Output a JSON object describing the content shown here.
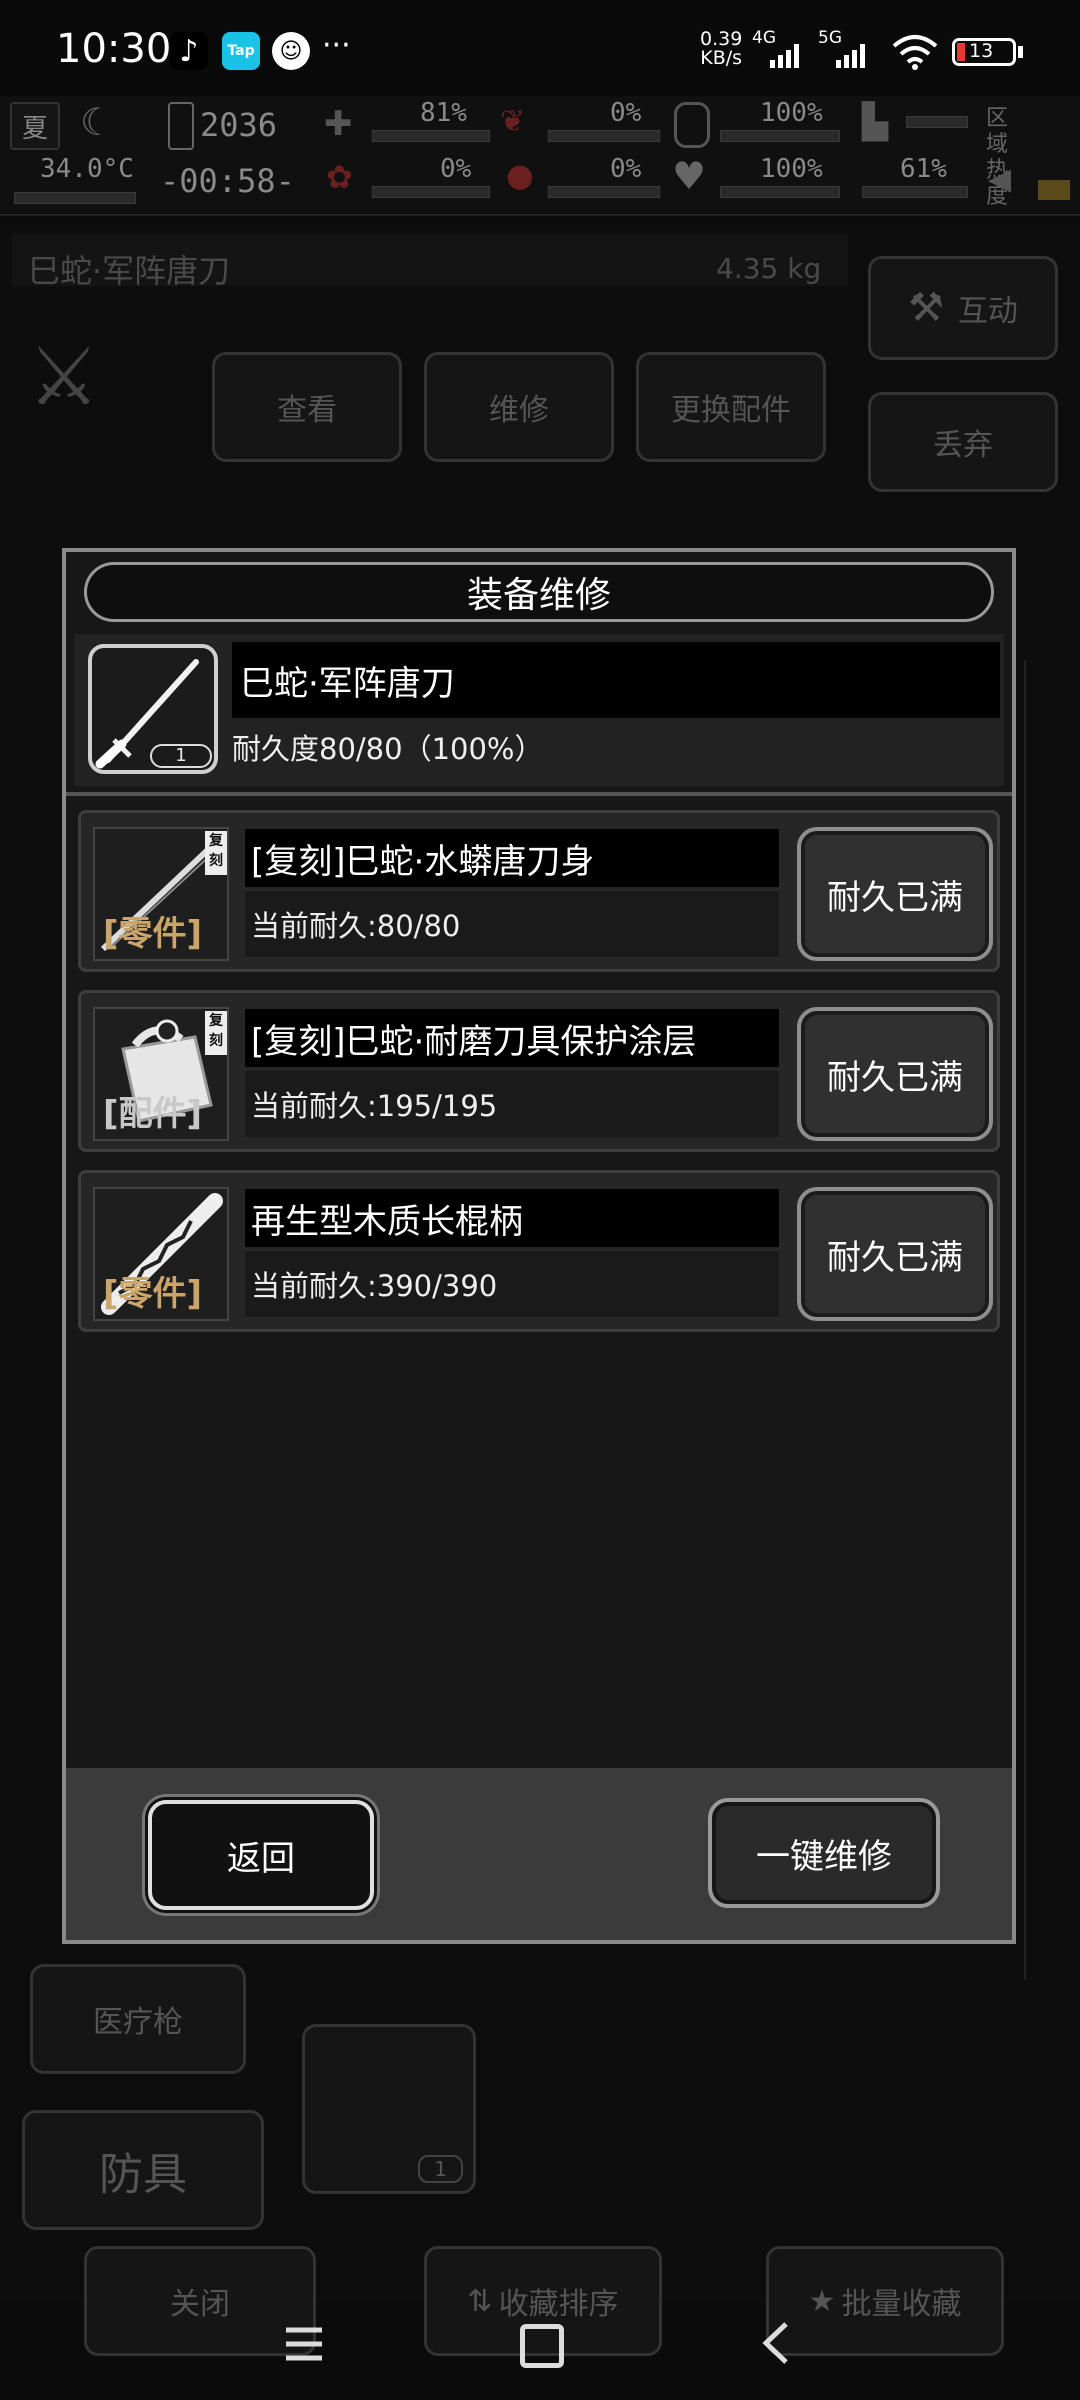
{
  "status_bar": {
    "time": "10:30",
    "more": "···",
    "net_speed_value": "0.39",
    "net_speed_unit": "KB/s",
    "net_4g": "4G",
    "net_5g": "5G",
    "battery": "13"
  },
  "hud": {
    "season": "夏",
    "temperature": "34.0°C",
    "clock": "2036",
    "timer": "-00:58-",
    "stat1": "81%",
    "stat2": "0%",
    "stat3": "100%",
    "stat4": "0%",
    "stat5": "0%",
    "stat6": "100%",
    "stat7": "61%",
    "zone_heat": "区域热度"
  },
  "background": {
    "item_name": "巳蛇·军阵唐刀",
    "item_weight": "4.35 kg",
    "btn_view": "查看",
    "btn_repair": "维修",
    "btn_swap": "更换配件",
    "btn_interact": "互动",
    "btn_discard": "丢弃",
    "side_medic": "医疗枪",
    "side_armor": "防具",
    "bottom_close": "关闭",
    "bottom_sort": "收藏排序",
    "bottom_batch": "批量收藏",
    "grid_count": "1"
  },
  "modal": {
    "title": "装备维修",
    "item": {
      "name": "巳蛇·军阵唐刀",
      "durability": "耐久度80/80（100%）",
      "count": "1"
    },
    "parts": [
      {
        "name": "[复刻]巳蛇·水蟒唐刀身",
        "durability": "当前耐久:80/80",
        "tag": "复刻",
        "kind": "零件",
        "button": "耐久已满"
      },
      {
        "name": "[复刻]巳蛇·耐磨刀具保护涂层",
        "durability": "当前耐久:195/195",
        "tag": "复刻",
        "kind": "配件",
        "button": "耐久已满"
      },
      {
        "name": "再生型木质长棍柄",
        "durability": "当前耐久:390/390",
        "tag": "",
        "kind": "零件",
        "button": "耐久已满"
      }
    ],
    "back_label": "返回",
    "repair_all_label": "一键维修"
  }
}
